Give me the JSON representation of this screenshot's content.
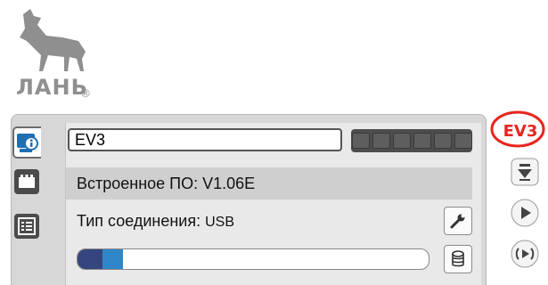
{
  "watermark": {
    "text": "ЛАНЬ",
    "registered_mark": "®"
  },
  "brick": {
    "name": "EV3",
    "battery_cells": 6,
    "firmware_text": "Встроенное ПО: V1.06E",
    "connection_label": "Тип соединения:",
    "connection_value": "USB",
    "memory_used_fraction": 0.13
  },
  "tabs": [
    {
      "name": "info",
      "icon": "info-icon",
      "active": true
    },
    {
      "name": "ports",
      "icon": "port-view-icon",
      "active": false
    },
    {
      "name": "list",
      "icon": "list-icon",
      "active": false
    }
  ],
  "controls": {
    "ev3_label": "EV3",
    "highlight_color": "#e8251f",
    "buttons": [
      "download-icon",
      "play-icon",
      "run-selected-icon"
    ]
  }
}
